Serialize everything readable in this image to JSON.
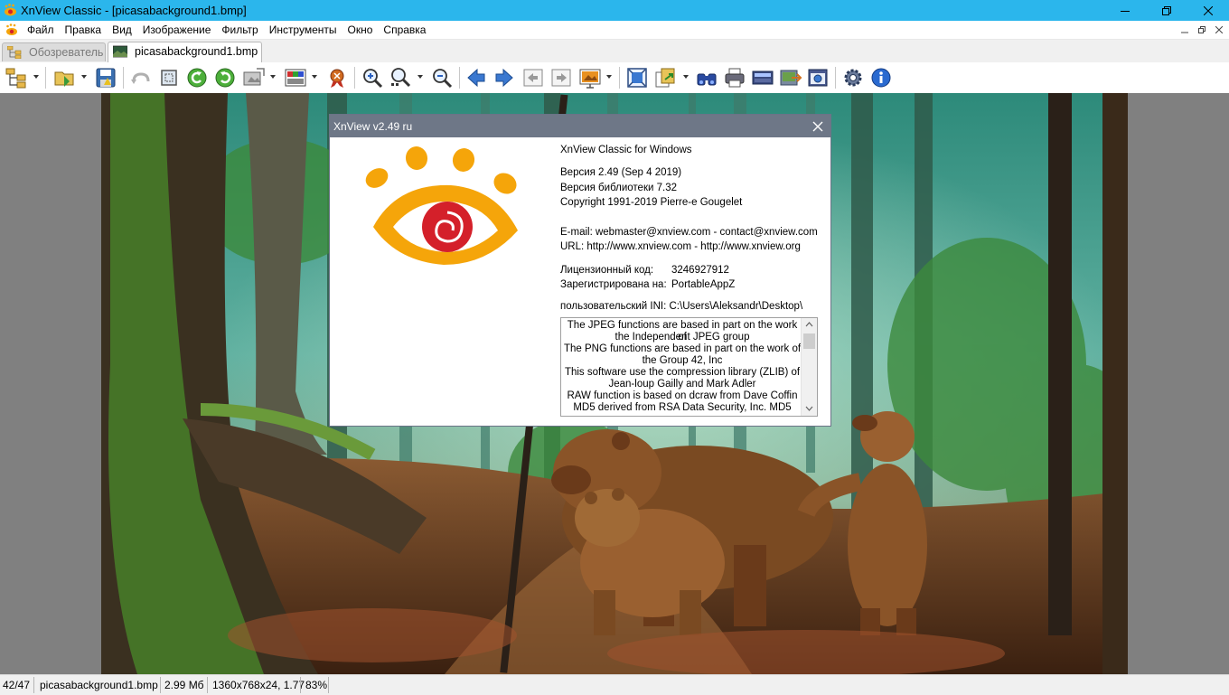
{
  "window": {
    "title": "XnView Classic - [picasabackground1.bmp]"
  },
  "menu": {
    "items": [
      "Файл",
      "Правка",
      "Вид",
      "Изображение",
      "Фильтр",
      "Инструменты",
      "Окно",
      "Справка"
    ]
  },
  "tabs": [
    {
      "label": "Обозреватель"
    },
    {
      "label": "picasabackground1.bmp"
    }
  ],
  "toolbar": {
    "icons": [
      "browser-tree-icon",
      "open-folder-icon",
      "save-icon",
      "undo-icon",
      "crop-icon",
      "rotate-left-icon",
      "rotate-right-icon",
      "resize-icon",
      "palette-icon",
      "ribbon-icon",
      "zoom-in-icon",
      "zoom-auto-icon",
      "zoom-out-icon",
      "previous-icon",
      "next-icon",
      "first-icon",
      "last-icon",
      "slideshow-icon",
      "fullscreen-icon",
      "convert-icon",
      "binoculars-icon",
      "print-icon",
      "scanner-icon",
      "export-icon",
      "capture-icon",
      "settings-icon",
      "info-icon"
    ]
  },
  "dialog": {
    "title": "XnView v2.49 ru",
    "product": "XnView Classic for Windows",
    "version": "Версия 2.49 (Sep  4 2019)",
    "library": "Версия библиотеки 7.32",
    "copyright": "Copyright 1991-2019 Pierre-e Gougelet",
    "email": "E-mail: webmaster@xnview.com - contact@xnview.com",
    "url": "URL: http://www.xnview.com - http://www.xnview.org",
    "license_label": "Лицензионный код:",
    "license_value": "3246927912",
    "registered_label": "Зарегистрирована на:",
    "registered_value": "PortableAppZ",
    "ini": "пользовательский INI: C:\\Users\\Aleksandr\\Desktop\\",
    "credits": [
      "The JPEG functions are based in part on the work of",
      "the Independent JPEG group",
      "The PNG functions are based in part on the work of",
      "the Group 42, Inc",
      "This software use the compression library (ZLIB) of",
      "Jean-loup Gailly and Mark Adler",
      "RAW function is based on dcraw from Dave Coffin",
      "MD5 derived from RSA Data Security, Inc. MD5"
    ]
  },
  "status": {
    "index": "42/47",
    "filename": "picasabackground1.bmp",
    "filesize": "2.99 Мб",
    "dimensions": "1360x768x24, 1.77",
    "zoom": "83%"
  },
  "colors": {
    "titlebar": "#2bb6ec",
    "dialog_title": "#6e7787",
    "logo_orange": "#f5a50a",
    "logo_red": "#d4202a"
  }
}
